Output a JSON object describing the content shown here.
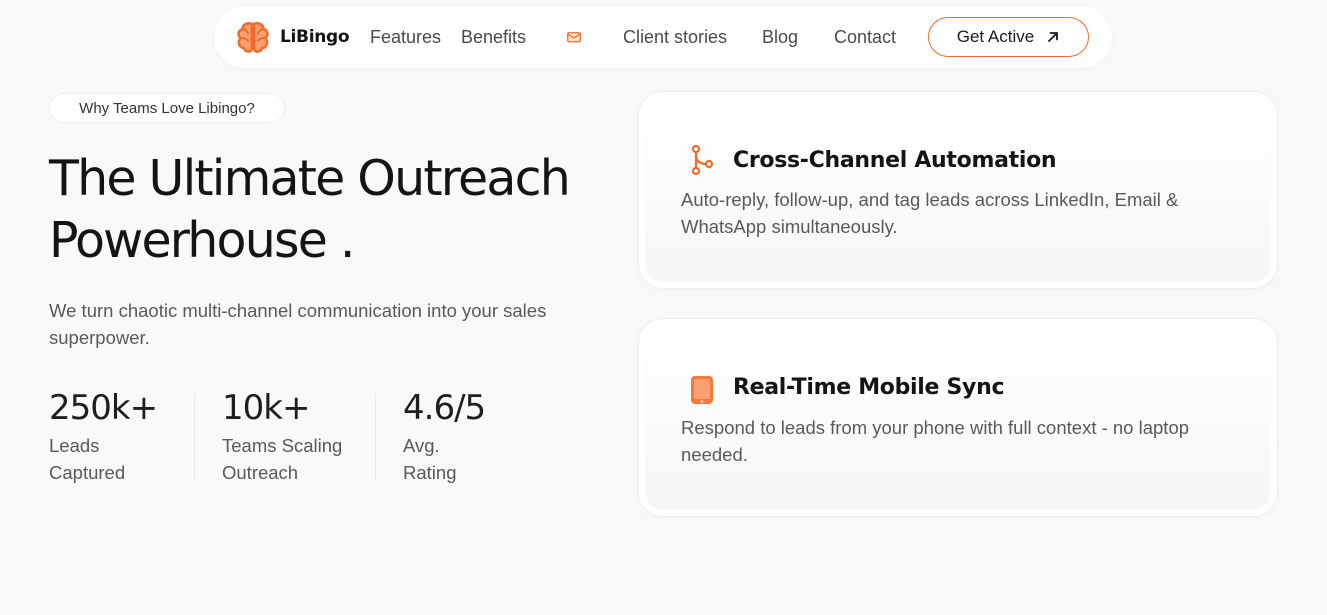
{
  "header": {
    "brand_name": "LiBingo",
    "nav": {
      "features": "Features",
      "benefits": "Benefits",
      "client_stories": "Client stories",
      "blog": "Blog",
      "contact": "Contact"
    },
    "cta_label": "Get Active",
    "icons": {
      "logo": "brain-icon",
      "mail": "mail-icon",
      "cta_arrow": "arrow-up-right-icon"
    }
  },
  "hero": {
    "eyebrow": "Why Teams Love Libingo?",
    "title_line1": "The Ultimate Outreach",
    "title_line2": "Powerhouse .",
    "subtitle": "We turn chaotic multi-channel communication into your sales superpower.",
    "stats": [
      {
        "value": "250k+",
        "label_line1": "Leads",
        "label_line2": "Captured"
      },
      {
        "value": "10k+",
        "label_line1": "Teams Scaling",
        "label_line2": "Outreach"
      },
      {
        "value": "4.6/5",
        "label_line1": "Avg.",
        "label_line2": "Rating"
      }
    ]
  },
  "features": [
    {
      "icon": "branch-flow-icon",
      "title": "Cross-Channel Automation",
      "description": "Auto-reply, follow-up, and tag leads across LinkedIn, Email & WhatsApp simultaneously."
    },
    {
      "icon": "mobile-phone-icon",
      "title": "Real-Time Mobile Sync",
      "description": "Respond to leads from your phone with full context - no laptop needed."
    }
  ],
  "colors": {
    "accent": "#f06a2a",
    "page_background": "#f9f9f7",
    "heading_text": "#141414",
    "body_text": "#595959"
  }
}
